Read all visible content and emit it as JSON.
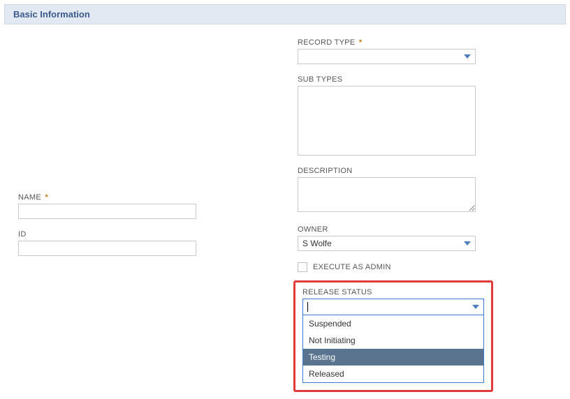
{
  "section": {
    "title": "Basic Information"
  },
  "left": {
    "name_label": "NAME",
    "name_value": "",
    "id_label": "ID",
    "id_value": ""
  },
  "right": {
    "record_type_label": "RECORD TYPE",
    "record_type_value": "",
    "sub_types_label": "SUB TYPES",
    "sub_types_value": "",
    "description_label": "DESCRIPTION",
    "description_value": "",
    "owner_label": "OWNER",
    "owner_value": "S Wolfe",
    "exec_admin_label": "EXECUTE AS ADMIN",
    "exec_admin_checked": false,
    "release_status_label": "RELEASE STATUS",
    "release_status_input": "",
    "release_options": {
      "o1": "Suspended",
      "o2": "Not Initiating",
      "o3": "Testing",
      "o4": "Released"
    },
    "release_hovered": "Testing"
  },
  "required_marker": "*"
}
